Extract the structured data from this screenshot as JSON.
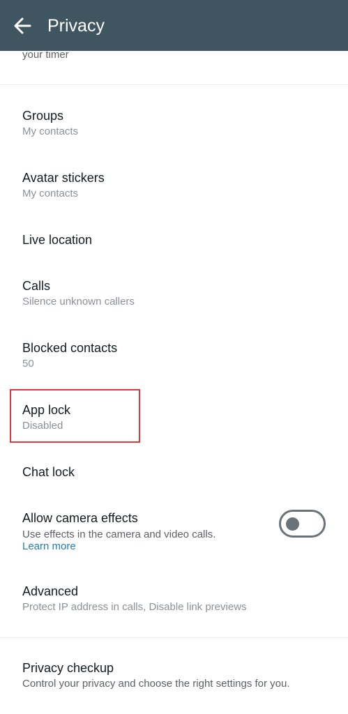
{
  "appbar": {
    "back_icon": "arrow-left-icon",
    "title": "Privacy"
  },
  "partial_item": {
    "subtitle": "your timer"
  },
  "items": {
    "groups": {
      "title": "Groups",
      "subtitle": "My contacts"
    },
    "avatar_stickers": {
      "title": "Avatar stickers",
      "subtitle": "My contacts"
    },
    "live_location": {
      "title": "Live location"
    },
    "calls": {
      "title": "Calls",
      "subtitle": "Silence unknown callers"
    },
    "blocked_contacts": {
      "title": "Blocked contacts",
      "subtitle": "50"
    },
    "app_lock": {
      "title": "App lock",
      "subtitle": "Disabled"
    },
    "chat_lock": {
      "title": "Chat lock"
    },
    "camera_effects": {
      "title": "Allow camera effects",
      "subtitle": "Use effects in the camera and video calls.",
      "link": "Learn more",
      "enabled": false
    },
    "advanced": {
      "title": "Advanced",
      "subtitle": "Protect IP address in calls, Disable link previews"
    },
    "privacy_checkup": {
      "title": "Privacy checkup",
      "subtitle": "Control your privacy and choose the right settings for you."
    }
  },
  "colors": {
    "appbar": "#3f5560",
    "highlight_border": "#e0383e",
    "link": "#1f7fb6"
  }
}
